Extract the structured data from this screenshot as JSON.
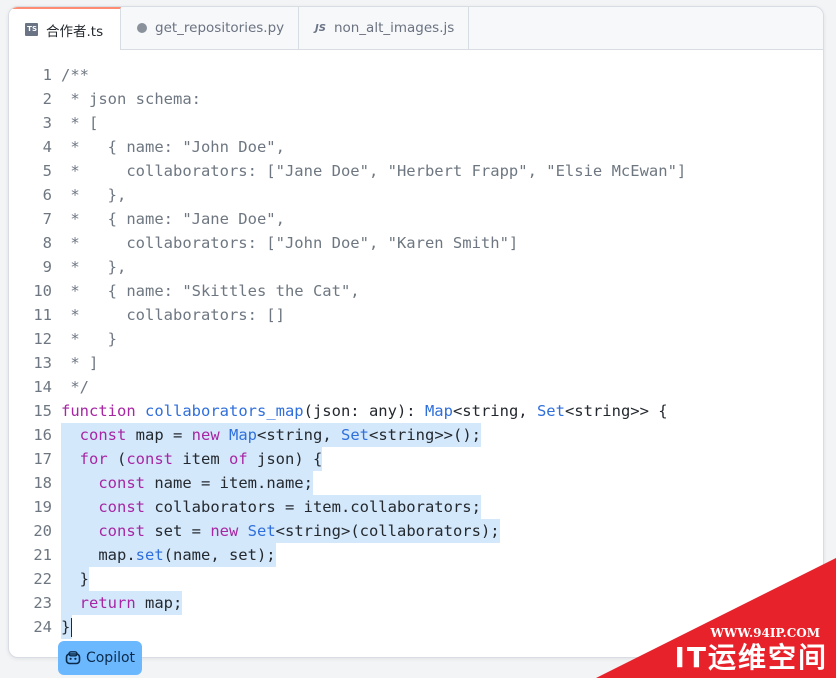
{
  "tabs": [
    {
      "label": "合作者.ts",
      "icon": "ts-file-icon",
      "badge": "TS",
      "active": true
    },
    {
      "label": "get_repositories.py",
      "icon": "python-file-icon",
      "active": false
    },
    {
      "label": "non_alt_images.js",
      "icon": "js-file-icon",
      "badge": "JS",
      "active": false
    }
  ],
  "code": {
    "line_numbers": [
      "1",
      "2",
      "3",
      "4",
      "5",
      "6",
      "7",
      "8",
      "9",
      "10",
      "11",
      "12",
      "13",
      "14",
      "15",
      "16",
      "17",
      "18",
      "19",
      "20",
      "21",
      "22",
      "23",
      "24"
    ],
    "lines": [
      [
        {
          "t": "/**",
          "c": "c"
        }
      ],
      [
        {
          "t": " * json schema:",
          "c": "c"
        }
      ],
      [
        {
          "t": " * [",
          "c": "c"
        }
      ],
      [
        {
          "t": " *   { name: \"John Doe\",",
          "c": "c"
        }
      ],
      [
        {
          "t": " *     collaborators: [\"Jane Doe\", \"Herbert Frapp\", \"Elsie McEwan\"]",
          "c": "c"
        }
      ],
      [
        {
          "t": " *   },",
          "c": "c"
        }
      ],
      [
        {
          "t": " *   { name: \"Jane Doe\",",
          "c": "c"
        }
      ],
      [
        {
          "t": " *     collaborators: [\"John Doe\", \"Karen Smith\"]",
          "c": "c"
        }
      ],
      [
        {
          "t": " *   },",
          "c": "c"
        }
      ],
      [
        {
          "t": " *   { name: \"Skittles the Cat\",",
          "c": "c"
        }
      ],
      [
        {
          "t": " *     collaborators: []",
          "c": "c"
        }
      ],
      [
        {
          "t": " *   }",
          "c": "c"
        }
      ],
      [
        {
          "t": " * ]",
          "c": "c"
        }
      ],
      [
        {
          "t": " */",
          "c": "c"
        }
      ],
      [
        {
          "t": "function",
          "c": "k"
        },
        {
          "t": " "
        },
        {
          "t": "collaborators_map",
          "c": "f"
        },
        {
          "t": "(json: any): "
        },
        {
          "t": "Map",
          "c": "t"
        },
        {
          "t": "<string, "
        },
        {
          "t": "Set",
          "c": "t"
        },
        {
          "t": "<string>> {"
        }
      ],
      [
        {
          "t": "  "
        },
        {
          "t": "const",
          "c": "k"
        },
        {
          "t": " map = "
        },
        {
          "t": "new",
          "c": "k"
        },
        {
          "t": " "
        },
        {
          "t": "Map",
          "c": "t"
        },
        {
          "t": "<string, "
        },
        {
          "t": "Set",
          "c": "t"
        },
        {
          "t": "<string>>();"
        }
      ],
      [
        {
          "t": "  "
        },
        {
          "t": "for",
          "c": "k"
        },
        {
          "t": " ("
        },
        {
          "t": "const",
          "c": "k"
        },
        {
          "t": " item "
        },
        {
          "t": "of",
          "c": "k"
        },
        {
          "t": " json) {"
        }
      ],
      [
        {
          "t": "    "
        },
        {
          "t": "const",
          "c": "k"
        },
        {
          "t": " name = item.name;"
        }
      ],
      [
        {
          "t": "    "
        },
        {
          "t": "const",
          "c": "k"
        },
        {
          "t": " collaborators = item.collaborators;"
        }
      ],
      [
        {
          "t": "    "
        },
        {
          "t": "const",
          "c": "k"
        },
        {
          "t": " set = "
        },
        {
          "t": "new",
          "c": "k"
        },
        {
          "t": " "
        },
        {
          "t": "Set",
          "c": "t"
        },
        {
          "t": "<string>(collaborators);"
        }
      ],
      [
        {
          "t": "    map."
        },
        {
          "t": "set",
          "c": "f"
        },
        {
          "t": "(name, set);"
        }
      ],
      [
        {
          "t": "  }"
        }
      ],
      [
        {
          "t": "  "
        },
        {
          "t": "return",
          "c": "k"
        },
        {
          "t": " map;"
        }
      ],
      [
        {
          "t": "}"
        }
      ]
    ],
    "suggestion_lines_start": 16,
    "suggestion_lines_end": 24,
    "cursor_line": 24
  },
  "copilot": {
    "label": "Copilot",
    "icon": "copilot-icon"
  },
  "watermark": {
    "url": "WWW.94IP.COM",
    "name": "IT运维空间"
  },
  "colors": {
    "keyword": "#a626a4",
    "function": "#2f6fdb",
    "comment": "#6e7781",
    "highlight": "#d4e8fb",
    "copilot_bg": "#6cb8ff",
    "watermark": "#e8222a"
  }
}
